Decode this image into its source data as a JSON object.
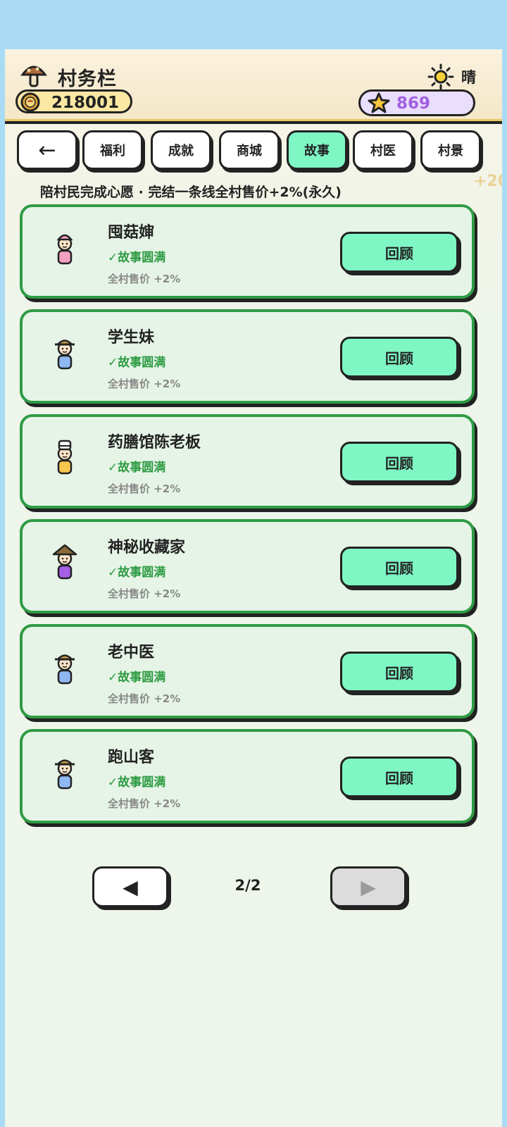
{
  "header": {
    "title": "村务栏",
    "coins": "218001",
    "weather": "晴",
    "stars": "869"
  },
  "tabs": [
    {
      "label": "←",
      "icon": "back-arrow-icon"
    },
    {
      "label": "福利"
    },
    {
      "label": "成就"
    },
    {
      "label": "商城"
    },
    {
      "label": "故事",
      "active": true
    },
    {
      "label": "村医"
    },
    {
      "label": "村景"
    }
  ],
  "subtitle": "陪村民完成心愿 · 完结一条线全村售价+2%(永久)",
  "peek_text": "+20",
  "stories": [
    {
      "name": "囤菇婶",
      "status": "✓故事圆满",
      "effect": "全村售价 +2%",
      "button": "回顾",
      "avatar_color": "#f4a0c0",
      "hat": "headscarf"
    },
    {
      "name": "学生妹",
      "status": "✓故事圆满",
      "effect": "全村售价 +2%",
      "button": "回顾",
      "avatar_color": "#8fb8f2",
      "hat": "cap"
    },
    {
      "name": "药膳馆陈老板",
      "status": "✓故事圆满",
      "effect": "全村售价 +2%",
      "button": "回顾",
      "avatar_color": "#f7c64c",
      "hat": "chef-hat"
    },
    {
      "name": "神秘收藏家",
      "status": "✓故事圆满",
      "effect": "全村售价 +2%",
      "button": "回顾",
      "avatar_color": "#a55ee6",
      "hat": "conical-hat"
    },
    {
      "name": "老中医",
      "status": "✓故事圆满",
      "effect": "全村售价 +2%",
      "button": "回顾",
      "avatar_color": "#8fb8f2",
      "hat": "cap"
    },
    {
      "name": "跑山客",
      "status": "✓故事圆满",
      "effect": "全村售价 +2%",
      "button": "回顾",
      "avatar_color": "#8fb8f2",
      "hat": "cap"
    }
  ],
  "pager": {
    "prev": "◀",
    "next": "▶",
    "page": "2/2"
  }
}
